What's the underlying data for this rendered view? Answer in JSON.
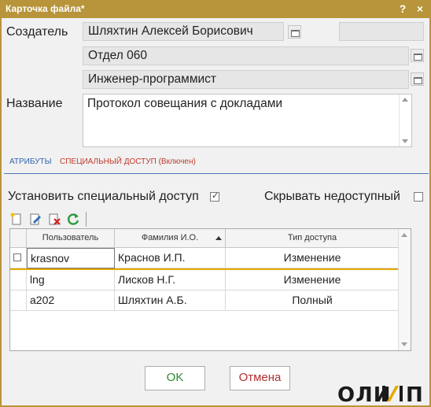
{
  "window": {
    "title": "Карточка файла*",
    "help_label": "?",
    "close_label": "×"
  },
  "form": {
    "creator_label": "Создатель",
    "creator_name": "Шляхтин Алексей Борисович",
    "department": "Отдел 060",
    "position": "Инженер-программист",
    "name_label": "Название",
    "name_value": "Протокол совещания с докладами"
  },
  "tabs": [
    {
      "label": "АТРИБУТЫ"
    },
    {
      "label": "СПЕЦИАЛЬНЫЙ ДОСТУП (Включен)"
    }
  ],
  "access": {
    "set_special_label": "Установить специальный доступ",
    "set_special_checked": true,
    "hide_unavailable_label": "Скрывать недоступный",
    "hide_unavailable_checked": false,
    "columns": [
      "Пользователь",
      "Фамилия И.О.",
      "Тип доступа"
    ],
    "rows": [
      {
        "user": "krasnov",
        "name": "Краснов И.П.",
        "access": "Изменение"
      },
      {
        "user": "lng",
        "name": "Лисков Н.Г.",
        "access": "Изменение"
      },
      {
        "user": "a202",
        "name": "Шляхтин А.Б.",
        "access": "Полный"
      }
    ]
  },
  "buttons": {
    "ok": "OK",
    "cancel": "Отмена"
  },
  "logo": {
    "text": "ОЛИМП"
  },
  "colors": {
    "titlebar": "#b8943a",
    "tab_active": "#c0392b",
    "tab_inactive": "#2e64b0",
    "ok_text": "#2e8b2e",
    "cancel_text": "#b33030",
    "selection_line": "#e4a800"
  }
}
